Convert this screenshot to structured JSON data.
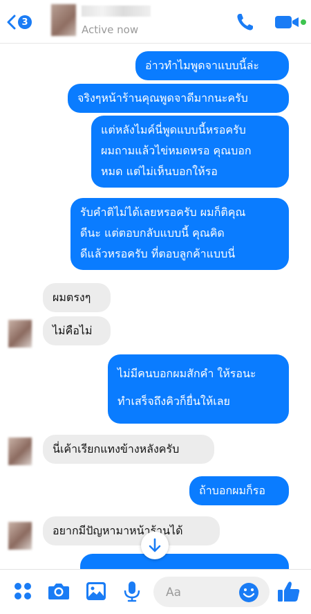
{
  "header": {
    "back_badge": "3",
    "status": "Active now"
  },
  "messages": [
    {
      "side": "out",
      "lines": [
        "อ่าวทำไมพูดจาแบบนี้ล่ะ"
      ]
    },
    {
      "side": "out",
      "lines": [
        "จริงๆหน้าร้านคุณพูดจาดีมากนะครับ"
      ]
    },
    {
      "side": "out",
      "lines": [
        "แต่หลังไมค์นี่พูดแบบนี้หรอครับ",
        "ผมถามแล้วไข่หมดหรอ คุณบอก",
        "หมด แต่ไม่เห็นบอกให้รอ"
      ]
    },
    {
      "side": "out",
      "lines": [
        "รับคำติไม่ได้เลยหรอครับ ผมก็ติคุณ",
        "ดีนะ แต่ตอบกลับแบบนี้ คุณคิด",
        "ดีแล้วหรอครับ ที่ตอบลูกค้าแบบนี่"
      ]
    },
    {
      "side": "in",
      "lines": [
        "ผมตรงๆ"
      ]
    },
    {
      "side": "in",
      "lines": [
        "ไม่คือไม่"
      ]
    },
    {
      "side": "out",
      "lines": [
        "ไม่มีคนบอกผมสักคำ ให้รอนะ",
        "ทำเสร็จถึงคิวก็ยื่นให้เลย"
      ]
    },
    {
      "side": "in",
      "lines": [
        "นี่เค้าเรียกแทงข้างหลังครับ"
      ]
    },
    {
      "side": "out",
      "lines": [
        "ถ้าบอกผมก็รอ"
      ]
    },
    {
      "side": "in",
      "lines": [
        "อยากมีปัญหามาหน้าร้านได้"
      ]
    }
  ],
  "composer": {
    "placeholder": "Aa"
  },
  "colors": {
    "accent": "#0a7cff",
    "incoming_bubble": "#ececec"
  },
  "icons": [
    "back-chevron-icon",
    "phone-icon",
    "video-camera-icon",
    "more-apps-icon",
    "camera-icon",
    "image-icon",
    "microphone-icon",
    "emoji-icon",
    "thumbs-up-icon",
    "arrow-down-icon"
  ]
}
